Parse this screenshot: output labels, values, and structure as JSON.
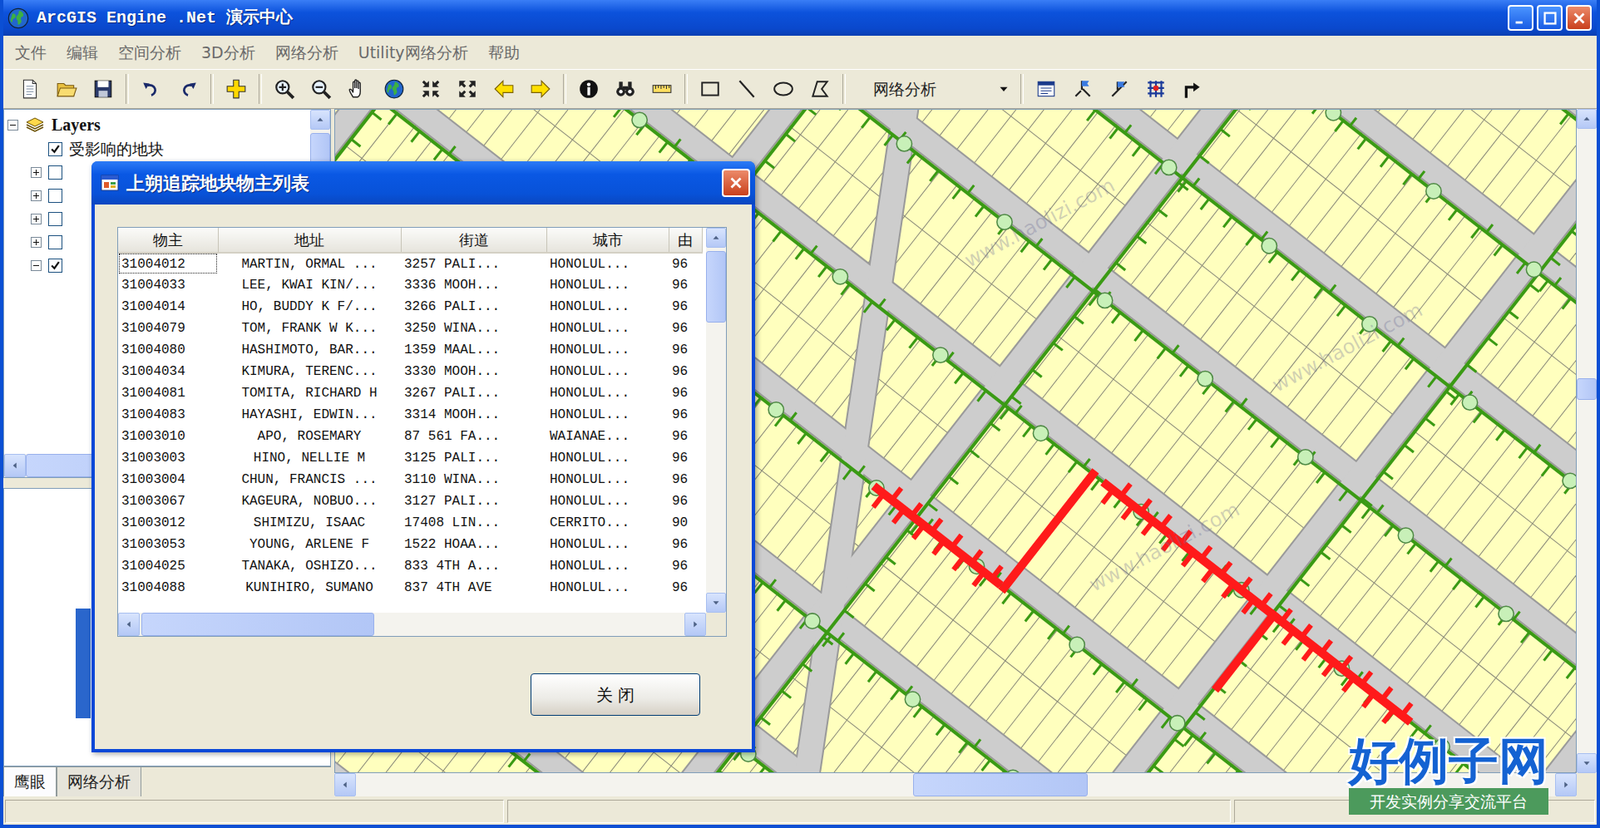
{
  "window": {
    "title": "ArcGIS Engine .Net 演示中心"
  },
  "menu": [
    "文件",
    "编辑",
    "空间分析",
    "3D分析",
    "网络分析",
    "Utility网络分析",
    "帮助"
  ],
  "toolbar": {
    "combo": "网络分析"
  },
  "toc": {
    "root": {
      "label": "Layers",
      "expanded": true
    },
    "layers": [
      {
        "label": "受影响的地块",
        "checked": true
      },
      {
        "checked": false,
        "expanded": false
      },
      {
        "checked": false,
        "expanded": false
      },
      {
        "checked": false,
        "expanded": false
      },
      {
        "checked": false,
        "expanded": false
      },
      {
        "checked": true,
        "expanded": true
      }
    ]
  },
  "left_tabs": [
    {
      "label": "鹰眼",
      "selected": true
    },
    {
      "label": "网络分析",
      "selected": false
    }
  ],
  "dialog": {
    "title": "上朔追踪地块物主列表",
    "table": {
      "columns": [
        "物主",
        "地址",
        "街道",
        "城市",
        "由"
      ],
      "rows": [
        {
          "cells": [
            "31004012",
            "MARTIN, ORMAL ...",
            "3257 PALI...",
            "HONOLUL...",
            "96"
          ],
          "focused": true
        },
        {
          "cells": [
            "31004033",
            "LEE, KWAI KIN/...",
            "3336 MOOH...",
            "HONOLUL...",
            "96"
          ],
          "focused": false
        },
        {
          "cells": [
            "31004014",
            "HO, BUDDY K F/...",
            "3266 PALI...",
            "HONOLUL...",
            "96"
          ],
          "focused": false
        },
        {
          "cells": [
            "31004079",
            "TOM, FRANK W K...",
            "3250 WINA...",
            "HONOLUL...",
            "96"
          ],
          "focused": false
        },
        {
          "cells": [
            "31004080",
            "HASHIMOTO, BAR...",
            "1359 MAAL...",
            "HONOLUL...",
            "96"
          ],
          "focused": false
        },
        {
          "cells": [
            "31004034",
            "KIMURA, TERENC...",
            "3330 MOOH...",
            "HONOLUL...",
            "96"
          ],
          "focused": false
        },
        {
          "cells": [
            "31004081",
            "TOMITA, RICHARD H",
            "3267 PALI...",
            "HONOLUL...",
            "96"
          ],
          "focused": false
        },
        {
          "cells": [
            "31004083",
            "HAYASHI, EDWIN...",
            "3314 MOOH...",
            "HONOLUL...",
            "96"
          ],
          "focused": false
        },
        {
          "cells": [
            "31003010",
            "APO, ROSEMARY",
            "87 561 FA...",
            "WAIANAE...",
            "96"
          ],
          "focused": false
        },
        {
          "cells": [
            "31003003",
            "HINO, NELLIE M",
            "3125 PALI...",
            "HONOLUL...",
            "96"
          ],
          "focused": false
        },
        {
          "cells": [
            "31003004",
            "CHUN, FRANCIS ...",
            "3110 WINA...",
            "HONOLUL...",
            "96"
          ],
          "focused": false
        },
        {
          "cells": [
            "31003067",
            "KAGEURA, NOBUO...",
            "3127 PALI...",
            "HONOLUL...",
            "96"
          ],
          "focused": false
        },
        {
          "cells": [
            "31003012",
            "SHIMIZU, ISAAC",
            "17408 LIN...",
            "CERRITO...",
            "90"
          ],
          "focused": false
        },
        {
          "cells": [
            "31003053",
            "YOUNG, ARLENE F",
            "1522 HOAA...",
            "HONOLUL...",
            "96"
          ],
          "focused": false
        },
        {
          "cells": [
            "31004025",
            "TANAKA, OSHIZO...",
            "833 4TH A...",
            "HONOLUL...",
            "96"
          ],
          "focused": false
        },
        {
          "cells": [
            "31004088",
            "KUNIHIRO, SUMANO",
            "837 4TH AVE",
            "HONOLUL...",
            "96"
          ],
          "focused": false
        }
      ]
    },
    "button": "关 闭"
  },
  "watermark": {
    "site": "www.haolizi.com",
    "logo": "好例子网",
    "slogan": "开发实例分享交流平台"
  }
}
